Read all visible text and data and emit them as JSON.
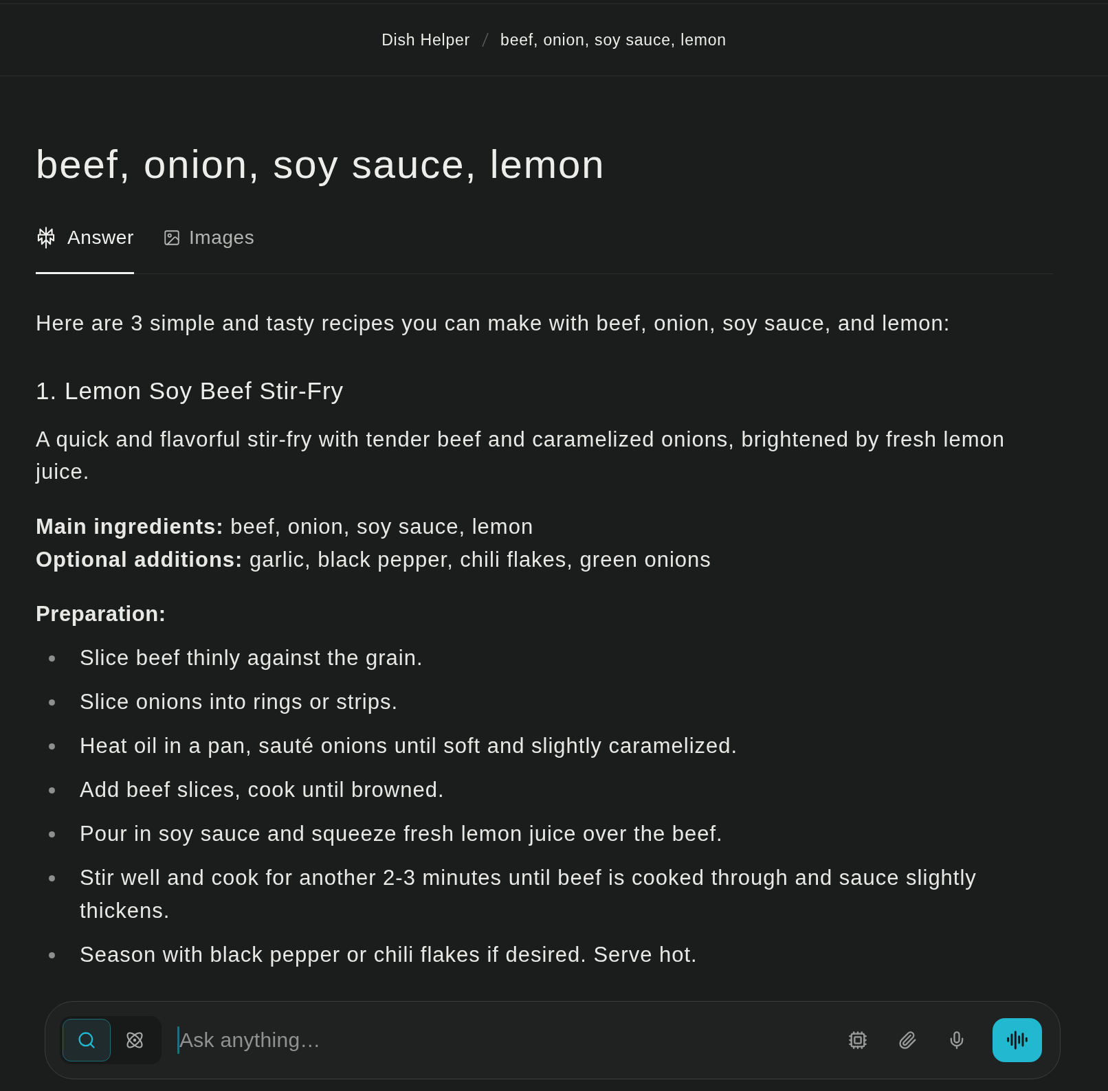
{
  "breadcrumb": [
    "Dish Helper",
    "beef, onion, soy sauce, lemon"
  ],
  "title": "beef, onion, soy sauce, lemon",
  "tabs": [
    {
      "label": "Answer",
      "selected": true
    },
    {
      "label": "Images",
      "selected": false
    }
  ],
  "intro": "Here are 3 simple and tasty recipes you can make with beef, onion, soy sauce, and lemon:",
  "recipe": {
    "heading": "1. Lemon Soy Beef Stir-Fry",
    "description": "A quick and flavorful stir-fry with tender beef and caramelized onions, brightened by fresh lemon juice.",
    "details": [
      "**Main ingredients:** beef, onion, soy sauce, lemon",
      "**Optional additions:** garlic, black pepper, chili flakes, green onions"
    ],
    "preparation_label": "Preparation:",
    "steps": [
      "Slice beef thinly against the grain.",
      "Slice onions into rings or strips.",
      "Heat oil in a pan, sauté onions until soft and slightly caramelized.",
      "Add beef slices, cook until browned.",
      "Pour in soy sauce and squeeze fresh lemon juice over the beef.",
      "Stir well and cook for another 2-3 minutes until beef is cooked through and sauce slightly thickens.",
      "Season with black pepper or chili flakes if desired. Serve hot."
    ]
  },
  "composer": {
    "modes": [
      {
        "selected": true
      },
      {
        "selected": false
      }
    ],
    "placeholder": "Ask anything…",
    "focused": true
  }
}
